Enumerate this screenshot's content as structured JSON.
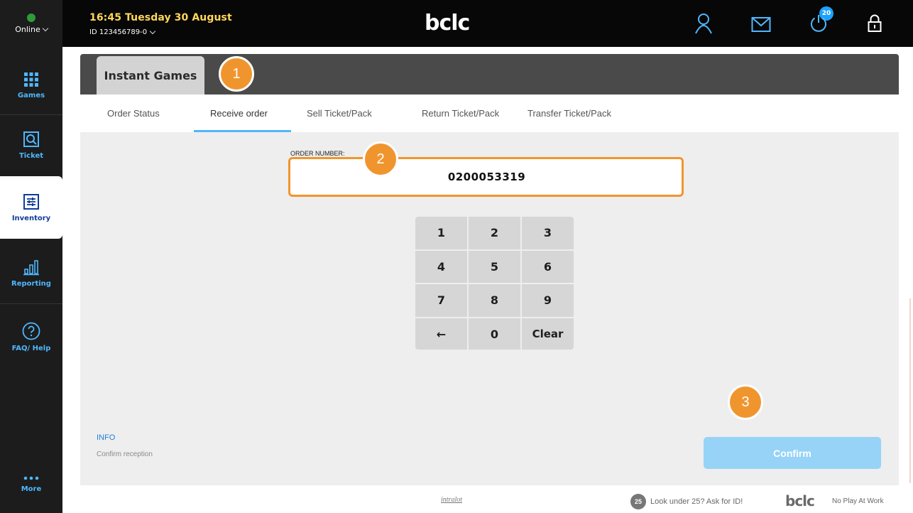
{
  "sidebar": {
    "status": {
      "label": "Online"
    },
    "items": [
      {
        "label": "Games",
        "icon": "grid-icon"
      },
      {
        "label": "Ticket",
        "icon": "ticket-search-icon"
      },
      {
        "label": "Inventory",
        "icon": "inventory-sliders-icon",
        "active": true
      },
      {
        "label": "Reporting",
        "icon": "bar-chart-icon"
      },
      {
        "label": "FAQ/ Help",
        "icon": "help-circle-icon"
      },
      {
        "label": "More",
        "icon": "more-dots-icon"
      }
    ]
  },
  "topbar": {
    "datetime": "16:45 Tuesday 30 August",
    "user_id": "ID 123456789-0",
    "logo": "bclc",
    "messages_badge": "20",
    "icons": [
      "user-icon",
      "mail-icon",
      "power-icon",
      "lock-icon"
    ]
  },
  "main": {
    "section_tab": "Instant Games",
    "subtabs": [
      {
        "label": "Order Status"
      },
      {
        "label": "Receive order",
        "active": true
      },
      {
        "label": "Sell Ticket/Pack"
      },
      {
        "label": "Return Ticket/Pack"
      },
      {
        "label": "Transfer Ticket/Pack"
      }
    ],
    "order_label": "ORDER NUMBER:",
    "order_value": "0200053319",
    "keypad": [
      "1",
      "2",
      "3",
      "4",
      "5",
      "6",
      "7",
      "8",
      "9",
      "←",
      "0",
      "Clear"
    ],
    "info_title": "INFO",
    "info_text": "Confirm reception",
    "confirm_label": "Confirm"
  },
  "callouts": [
    "1",
    "2",
    "3"
  ],
  "footer": {
    "intralot": "intralot",
    "age_badge": "25",
    "age_text": "Look under 25? Ask for ID!",
    "bclc": "bclc",
    "slogan": "No Play At Work"
  },
  "colors": {
    "sidebar_bg": "#1c1c1c",
    "topbar_bg": "#070707",
    "accent_blue": "#4fb7ff",
    "active_navy": "#0f3d9a",
    "callout_orange": "#f0952e",
    "confirm_disabled": "#96d3f7",
    "datetime_yellow": "#ffd75a"
  }
}
